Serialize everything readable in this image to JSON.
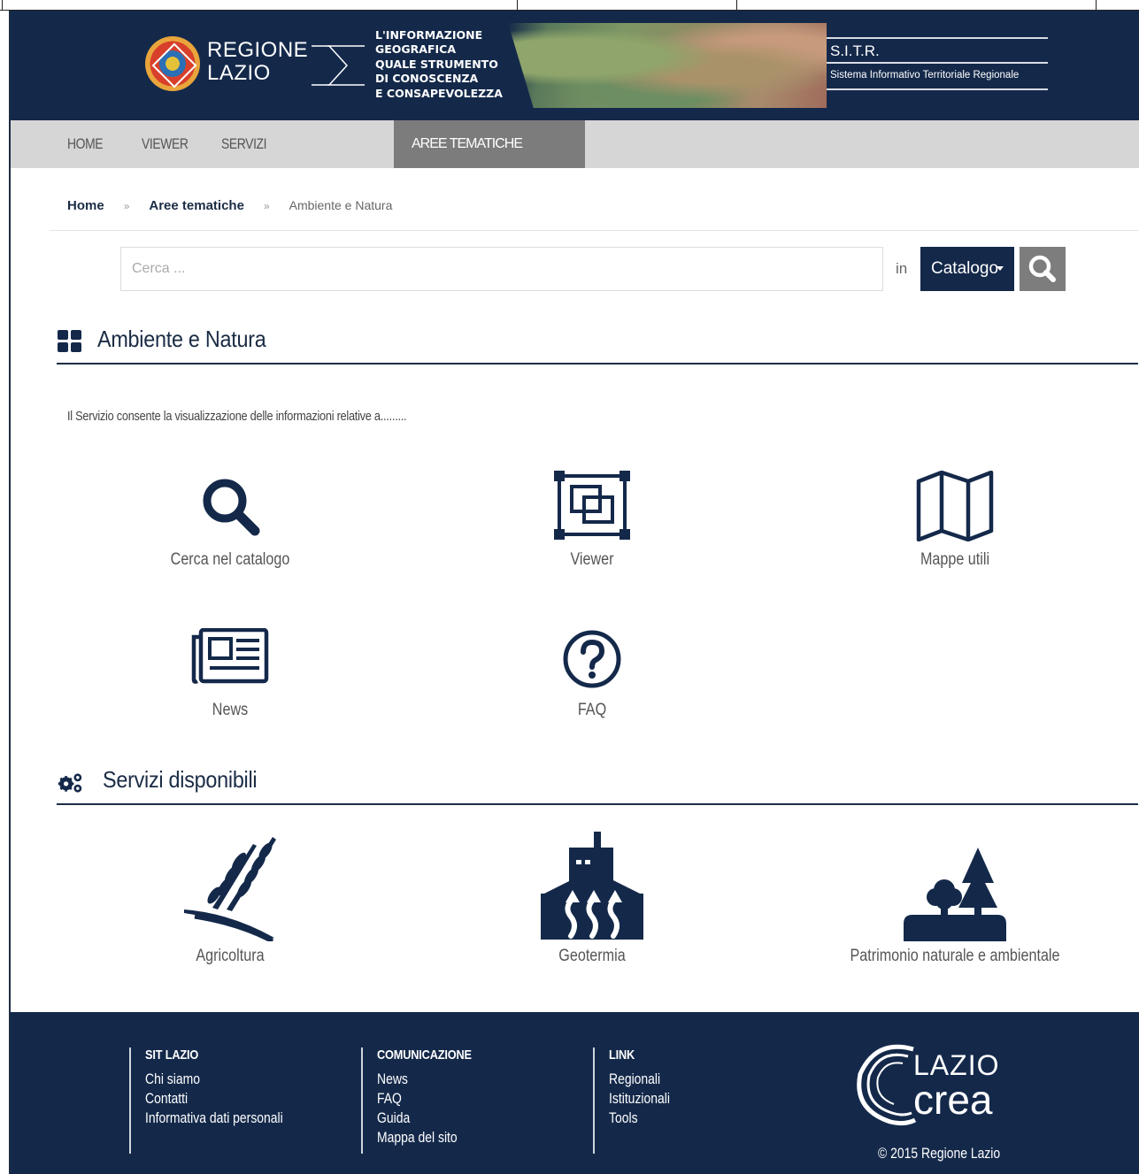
{
  "header": {
    "logo_line1": "REGIONE",
    "logo_line2": "LAZIO",
    "tagline": [
      "L'INFORMAZIONE",
      "GEOGRAFICA",
      "QUALE STRUMENTO",
      "DI CONOSCENZA",
      "E CONSAPEVOLEZZA"
    ],
    "sitr_title": "S.I.T.R.",
    "sitr_subtitle": "Sistema Informativo Territoriale Regionale"
  },
  "nav": {
    "items": [
      {
        "label": "HOME"
      },
      {
        "label": "VIEWER"
      },
      {
        "label": "SERVIZI"
      },
      {
        "label": "AREE TEMATICHE",
        "active": true
      }
    ]
  },
  "breadcrumb": {
    "home": "Home",
    "separator": "»",
    "section": "Aree tematiche",
    "current": "Ambiente e Natura"
  },
  "search": {
    "placeholder": "Cerca ...",
    "in_label": "in",
    "scope": "Catalogo"
  },
  "area": {
    "title": "Ambiente e Natura",
    "icon": "th-large-icon",
    "intro": "Il Servizio consente la visualizzazione delle informazioni relative a.........",
    "tiles": [
      {
        "label": "Cerca nel catalogo",
        "icon": "search-icon"
      },
      {
        "label": "Viewer",
        "icon": "viewer-icon"
      },
      {
        "label": "Mappe utili",
        "icon": "map-icon"
      },
      {
        "label": "News",
        "icon": "newspaper-icon"
      },
      {
        "label": "FAQ",
        "icon": "question-circle-icon"
      }
    ]
  },
  "services": {
    "title": "Servizi disponibili",
    "icon": "cogs-icon",
    "tiles": [
      {
        "label": "Agricoltura",
        "icon": "wheat-icon"
      },
      {
        "label": "Geotermia",
        "icon": "geothermal-icon"
      },
      {
        "label": "Patrimonio naturale e ambientale",
        "icon": "trees-icon"
      }
    ]
  },
  "footer": {
    "columns": [
      {
        "heading": "SIT LAZIO",
        "links": [
          "Chi siamo",
          "Contatti",
          "Informativa dati personali"
        ]
      },
      {
        "heading": "COMUNICAZIONE",
        "links": [
          "News",
          "FAQ",
          "Guida",
          "Mappa del sito"
        ]
      },
      {
        "heading": "LINK",
        "links": [
          "Regionali",
          "Istituzionali",
          "Tools"
        ]
      }
    ],
    "logo_line1": "LAZIO",
    "logo_line2": "crea",
    "copyright": "© 2015 Regione Lazio"
  },
  "colors": {
    "primary": "#14294a",
    "nav_bg": "#d6d6d6",
    "nav_active": "#7c7c7c",
    "search_button": "#7d7d7d"
  }
}
